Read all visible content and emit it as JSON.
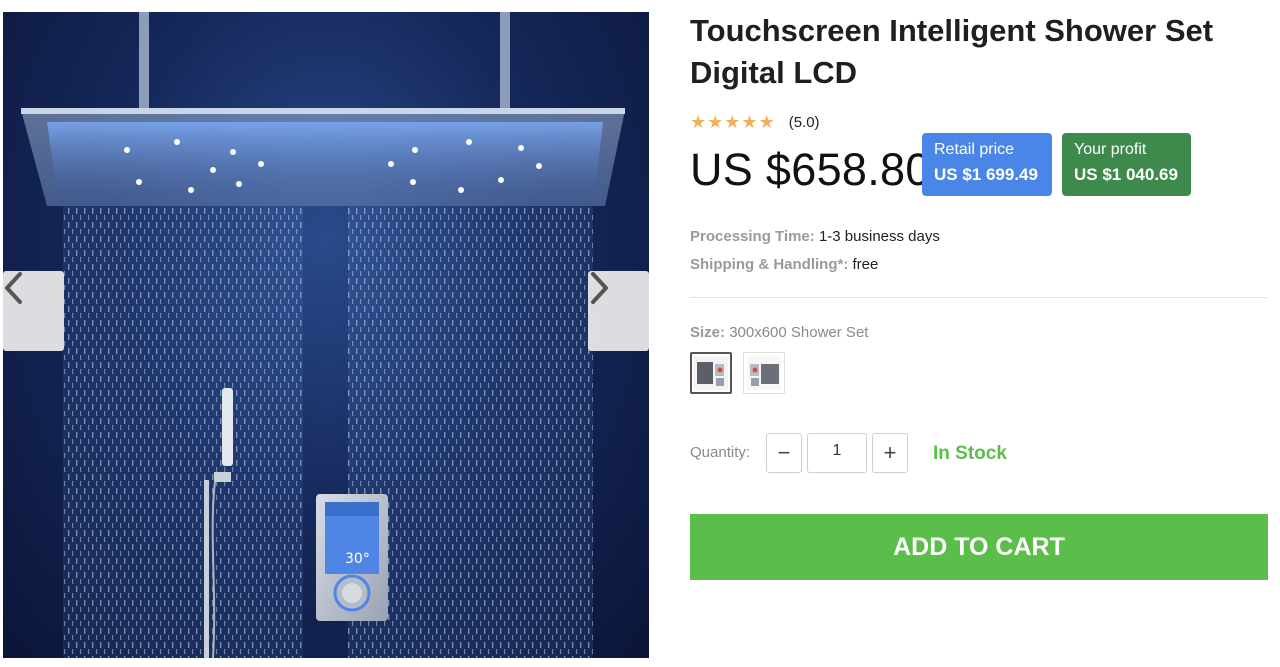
{
  "product": {
    "title": "Touchscreen Intelligent Shower Set Digital LCD",
    "image_alt": "ceiling rain shower with LED lights, hand shower and digital thermostat panel",
    "panel_temperature": "30°"
  },
  "gallery": {
    "prev_icon": "chevron-left-icon",
    "next_icon": "chevron-right-icon"
  },
  "rating": {
    "stars": 5,
    "value_text": "(5.0)",
    "star_color": "#f2b05a"
  },
  "pricing": {
    "price": "US $658.80",
    "retail": {
      "label": "Retail price",
      "value": "US $1 699.49",
      "color": "#4a86e8"
    },
    "profit": {
      "label": "Your profit",
      "value": "US $1 040.69",
      "color": "#3d8a4c"
    }
  },
  "shipping": {
    "processing_label": "Processing Time:",
    "processing_value": "1-3 business days",
    "shipping_label": "Shipping & Handling*:",
    "shipping_value": "free"
  },
  "size": {
    "label": "Size:",
    "selected": "300x600 Shower Set",
    "swatch_count": 2
  },
  "quantity": {
    "label": "Quantity:",
    "value": "1",
    "minus_symbol": "−",
    "plus_symbol": "+"
  },
  "stock_status": "In Stock",
  "cart": {
    "label": "ADD TO CART",
    "color": "#5bbd4a"
  }
}
